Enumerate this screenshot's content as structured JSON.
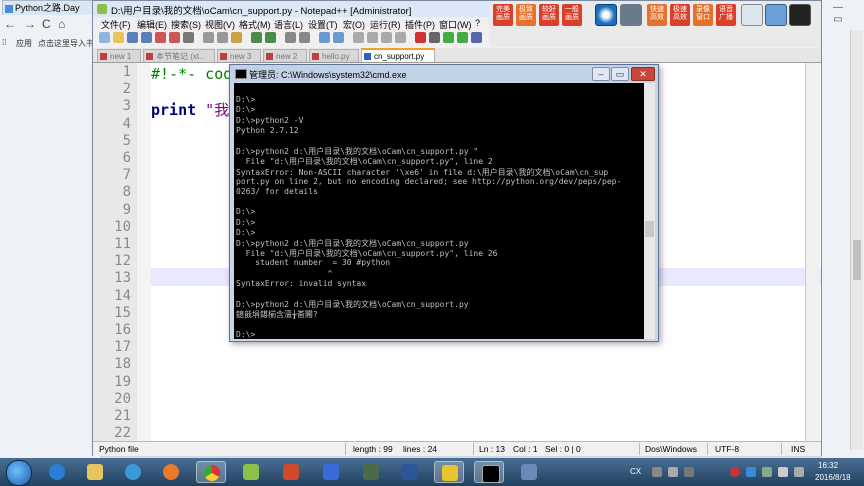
{
  "browser": {
    "tab_title": "Python之路.Day",
    "bookmarks_label": "应用",
    "bookmarks_hint": "点击这里导入书"
  },
  "npp": {
    "title": "D:\\用户目录\\我的文档\\oCam\\cn_support.py - Notepad++ [Administrator]",
    "menu": [
      "文件(F)",
      "编辑(E)",
      "搜索(S)",
      "视图(V)",
      "格式(M)",
      "语言(L)",
      "设置(T)",
      "宏(O)",
      "运行(R)",
      "插件(P)",
      "窗口(W)",
      "?"
    ],
    "big_buttons": [
      {
        "label": "完美画质",
        "color": "#d8402b"
      },
      {
        "label": "极致画质",
        "color": "#e5712b"
      },
      {
        "label": "较好画质",
        "color": "#d8402b"
      },
      {
        "label": "一般画质",
        "color": "#d8402b"
      },
      {
        "label": "快速高效",
        "color": "#e5712b"
      },
      {
        "label": "极速高效",
        "color": "#d8402b"
      },
      {
        "label": "录像窗口",
        "color": "#e5712b"
      },
      {
        "label": "语音广播",
        "color": "#d8402b"
      }
    ],
    "tabs": [
      {
        "label": "new 1",
        "active": false
      },
      {
        "label": "本节笔记 (xt..",
        "active": false
      },
      {
        "label": "new 3",
        "active": false
      },
      {
        "label": "new 2",
        "active": false
      },
      {
        "label": "hello.py",
        "active": false
      },
      {
        "label": "cn_support.py",
        "active": true
      }
    ],
    "line_numbers": [
      "1",
      "2",
      "3",
      "4",
      "5",
      "6",
      "7",
      "8",
      "9",
      "10",
      "11",
      "12",
      "13",
      "14",
      "15",
      "16",
      "17",
      "18",
      "19",
      "20",
      "21",
      "22"
    ],
    "code_line1": "#!-*- coding:utf-8 -*-",
    "code_line3_kw": "print",
    "code_line3_str": " \"我",
    "current_line": 13,
    "status": {
      "file_type": "Python file",
      "length": "length : 99",
      "lines": "lines : 24",
      "ln": "Ln : 13",
      "col": "Col : 1",
      "sel": "Sel : 0 | 0",
      "eol": "Dos\\Windows",
      "encoding": "UTF-8",
      "mode": "INS"
    }
  },
  "cmd": {
    "title": "管理员: C:\\Windows\\system32\\cmd.exe",
    "lines": [
      "",
      "D:\\>",
      "D:\\>",
      "D:\\>python2 -V",
      "Python 2.7.12",
      "",
      "D:\\>python2 d:\\用户目录\\我的文档\\oCam\\cn_support.py \"",
      "  File \"d:\\用户目录\\我的文档\\oCam\\cn_support.py\", line 2",
      "SyntaxError: Non-ASCII character '\\xe6' in file d:\\用户目录\\我的文档\\oCam\\cn_sup",
      "port.py on line 2, but no encoding declared; see http://python.org/dev/peps/pep-",
      "0263/ for details",
      "",
      "D:\\>",
      "D:\\>",
      "D:\\>",
      "D:\\>python2 d:\\用户目录\\我的文档\\oCam\\cn_support.py",
      "  File \"d:\\用户目录\\我的文档\\oCam\\cn_support.py\", line 26",
      "    student number  = 30 #python",
      "                   ^",
      "SyntaxError: invalid syntax",
      "",
      "D:\\>python2 d:\\用户目录\\我的文档\\oCam\\cn_support.py",
      "鎴戠埍鍖椾含澶╁畨闂?",
      "",
      "D:\\>"
    ]
  },
  "taskbar": {
    "lang": "CX",
    "time": "16:32",
    "date": "2016/8/18"
  }
}
